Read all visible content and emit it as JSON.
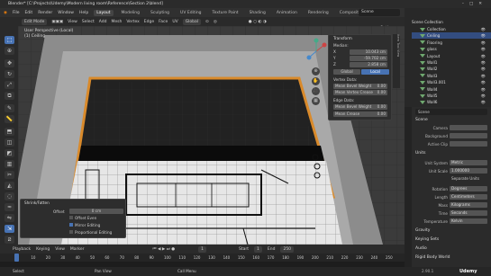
{
  "titlebar": {
    "title": "Blender* [C:\\Projects\\Udemy\\Modern living room\\Reference\\Section 2\\blend]"
  },
  "menubar": {
    "items": [
      "File",
      "Edit",
      "Render",
      "Window",
      "Help"
    ],
    "tabs": [
      "Layout",
      "Modeling",
      "Sculpting",
      "UV Editing",
      "Texture Paint",
      "Shading",
      "Animation",
      "Rendering",
      "Compositing",
      "Geometry"
    ],
    "active_tab": "Layout",
    "scene": "Scene",
    "view_layer": "ViewLayer"
  },
  "header3d": {
    "mode": "Edit Mode",
    "items": [
      "View",
      "Select",
      "Add",
      "Mesh",
      "Vertex",
      "Edge",
      "Face",
      "UV"
    ],
    "orientation": "Global",
    "options": "Options"
  },
  "overlay": {
    "view": "User Perspective (Local)",
    "object": "(1) Ceiling"
  },
  "npanel": {
    "header": "Transform",
    "median": "Median:",
    "x_label": "X",
    "x_val": "10.043 cm",
    "y_label": "Y",
    "y_val": "-59.702 cm",
    "z_label": "Z",
    "z_val": "2.858 cm",
    "global": "Global",
    "local": "Local",
    "vertex_data": "Vertex Data:",
    "mean_bevel_vertex": "Mean Bevel Weight",
    "mean_bevel_vertex_val": "0.00",
    "mean_vertex_crease": "Mean Vertex Crease",
    "mean_vertex_crease_val": "0.00",
    "edge_data": "Edge Data:",
    "mean_bevel_edge": "Mean Bevel Weight",
    "mean_bevel_edge_val": "0.00",
    "mean_crease": "Mean Crease",
    "mean_crease_val": "0.00"
  },
  "operator": {
    "title": "Shrink/Fatten",
    "offset_label": "Offset",
    "offset_value": "0 cm",
    "even_thickness": "Offset Even",
    "mirror_editing": "Mirror Editing",
    "proportional_editing": "Proportional Editing"
  },
  "timeline": {
    "items": [
      "Playback",
      "Keying",
      "View",
      "Marker"
    ],
    "start_label": "Start",
    "start": "1",
    "end_label": "End",
    "end": "250",
    "current": "1"
  },
  "ruler": {
    "ticks": [
      "0",
      "10",
      "20",
      "30",
      "40",
      "50",
      "60",
      "70",
      "80",
      "90",
      "100",
      "110",
      "120",
      "130",
      "140",
      "150",
      "160",
      "170",
      "180",
      "190",
      "200",
      "210",
      "220",
      "230",
      "240",
      "250"
    ]
  },
  "statusbar": {
    "select": "Select",
    "pan": "Pan View",
    "menu": "Call Menu",
    "version": "2.90.1",
    "watermark": "Udemy"
  },
  "outliner": {
    "title": "Scene Collection",
    "items": [
      {
        "name": "Collection",
        "selected": false
      },
      {
        "name": "Ceiling",
        "selected": true
      },
      {
        "name": "Flooring",
        "selected": false
      },
      {
        "name": "glass",
        "selected": false
      },
      {
        "name": "Layout",
        "selected": false
      },
      {
        "name": "Wall1",
        "selected": false
      },
      {
        "name": "Wall2",
        "selected": false
      },
      {
        "name": "Wall3",
        "selected": false
      },
      {
        "name": "Wall3.001",
        "selected": false
      },
      {
        "name": "Wall4",
        "selected": false
      },
      {
        "name": "Wall5",
        "selected": false
      },
      {
        "name": "Wall6",
        "selected": false
      }
    ]
  },
  "props": {
    "scene_name": "Scene",
    "scene_section": "Scene",
    "camera_label": "Camera",
    "background_label": "Background",
    "active_clip_label": "Active Clip",
    "units_section": "Units",
    "unit_system_label": "Unit System",
    "unit_system": "Metric",
    "unit_scale_label": "Unit Scale",
    "unit_scale": "1.000000",
    "separate_units": "Separate Units",
    "rotation_label": "Rotation",
    "rotation": "Degrees",
    "length_label": "Length",
    "length": "Centimeters",
    "mass_label": "Mass",
    "mass": "Kilograms",
    "time_label": "Time",
    "time": "Seconds",
    "temperature_label": "Temperature",
    "temperature": "Kelvin",
    "gravity": "Gravity",
    "keying_sets": "Keying Sets",
    "audio": "Audio",
    "rigid_body_world": "Rigid Body World"
  }
}
